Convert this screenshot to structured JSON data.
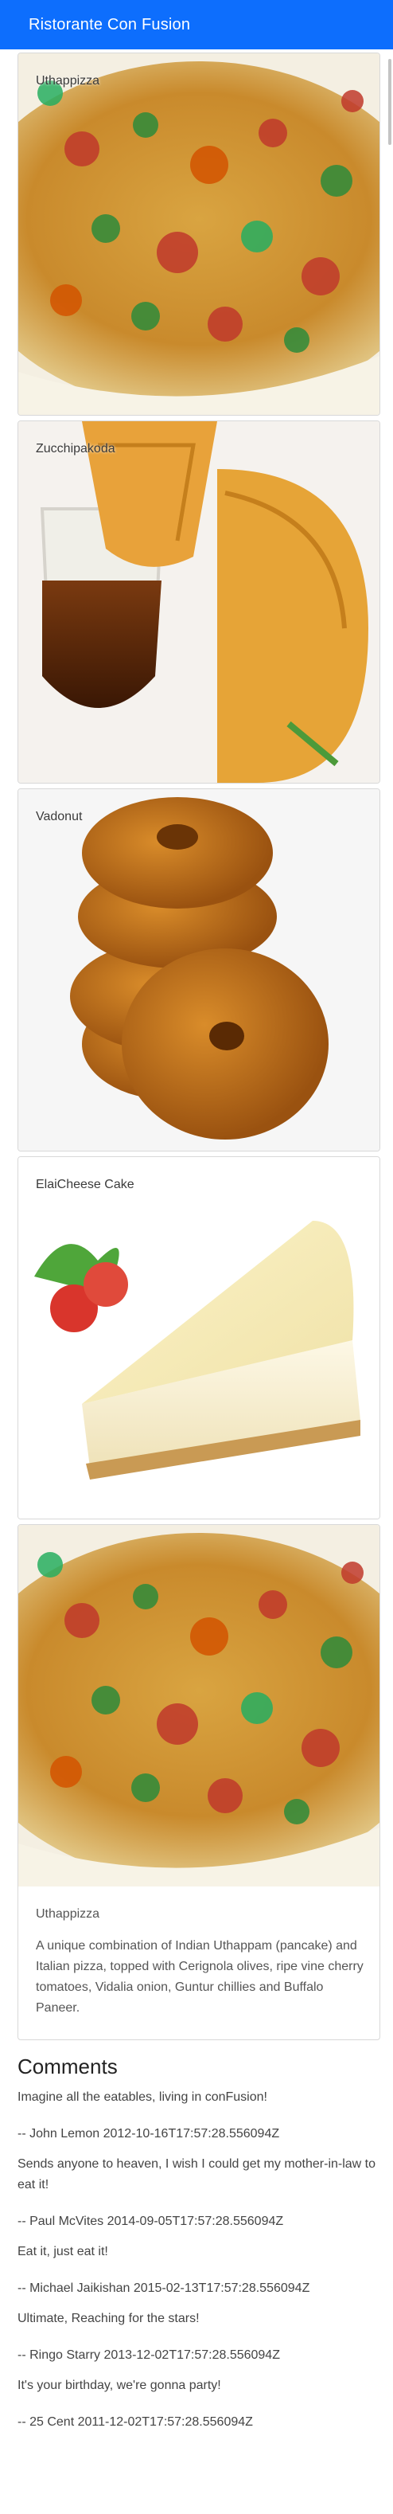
{
  "navbar": {
    "brand": "Ristorante Con Fusion"
  },
  "menu": [
    {
      "name": "Uthappizza",
      "image": "pizza"
    },
    {
      "name": "Zucchipakoda",
      "image": "pakoda"
    },
    {
      "name": "Vadonut",
      "image": "donut"
    },
    {
      "name": "ElaiCheese Cake",
      "image": "cheesecake"
    }
  ],
  "selected_dish": {
    "name": "Uthappizza",
    "image": "pizza",
    "description": "A unique combination of Indian Uthappam (pancake) and Italian pizza, topped with Cerignola olives, ripe vine cherry tomatoes, Vidalia onion, Guntur chillies and Buffalo Paneer."
  },
  "comments": {
    "heading": "Comments",
    "items": [
      {
        "text": "Imagine all the eatables, living in conFusion!",
        "author": "John Lemon",
        "date": "2012-10-16T17:57:28.556094Z",
        "meta": "-- John Lemon 2012-10-16T17:57:28.556094Z"
      },
      {
        "text": "Sends anyone to heaven, I wish I could get my mother-in-law to eat it!",
        "author": "Paul McVites",
        "date": "2014-09-05T17:57:28.556094Z",
        "meta": "-- Paul McVites 2014-09-05T17:57:28.556094Z"
      },
      {
        "text": "Eat it, just eat it!",
        "author": "Michael Jaikishan",
        "date": "2015-02-13T17:57:28.556094Z",
        "meta": "-- Michael Jaikishan 2015-02-13T17:57:28.556094Z"
      },
      {
        "text": "Ultimate, Reaching for the stars!",
        "author": "Ringo Starry",
        "date": "2013-12-02T17:57:28.556094Z",
        "meta": "-- Ringo Starry 2013-12-02T17:57:28.556094Z"
      },
      {
        "text": "It's your birthday, we're gonna party!",
        "author": "25 Cent",
        "date": "2011-12-02T17:57:28.556094Z",
        "meta": "-- 25 Cent 2011-12-02T17:57:28.556094Z"
      }
    ]
  },
  "colors": {
    "navbar": "#0d6efd",
    "navbar_text": "#ffffff",
    "card_border": "#d8d8d8"
  }
}
